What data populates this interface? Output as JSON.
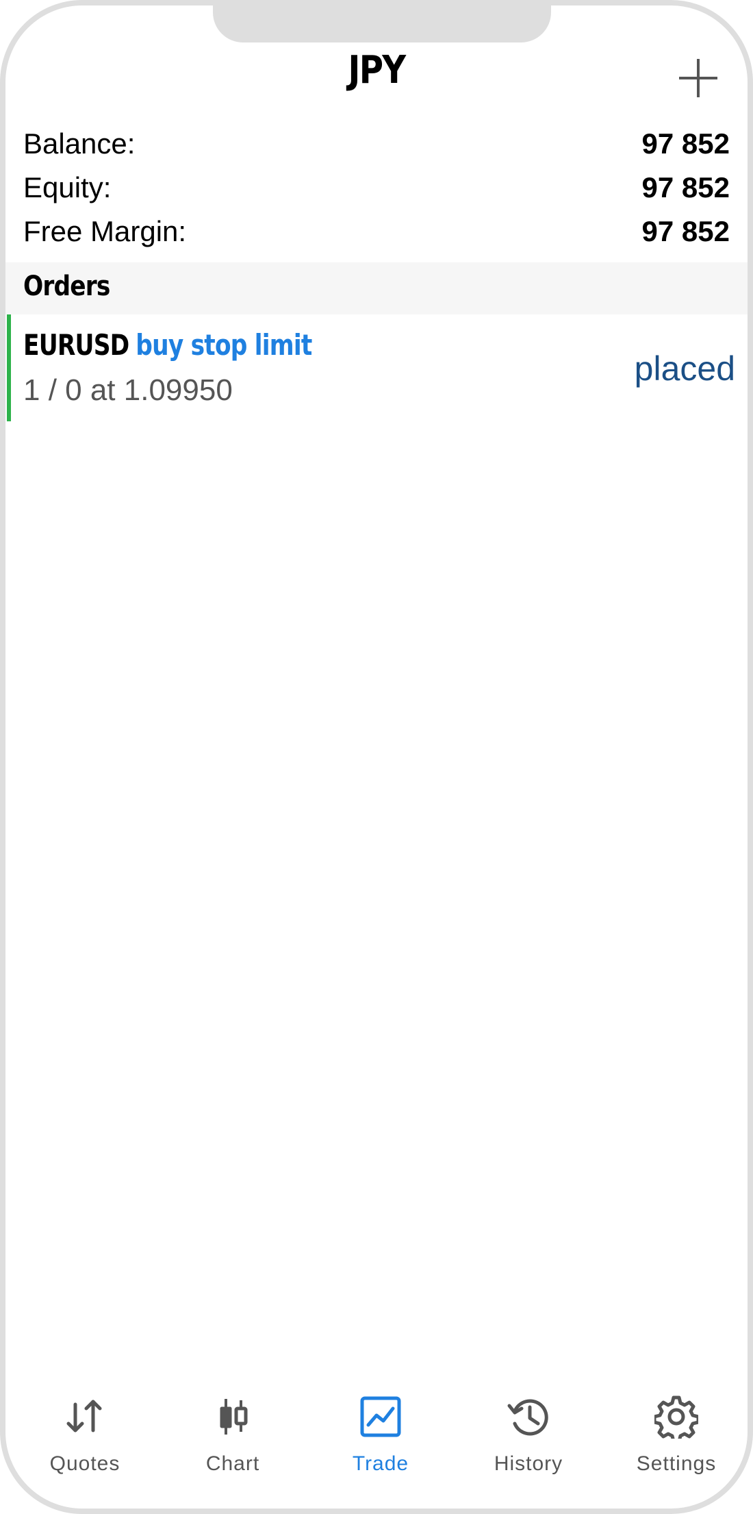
{
  "header": {
    "title": "JPY",
    "add_icon": "plus-icon"
  },
  "account": [
    {
      "label": "Balance:",
      "value": "97 852"
    },
    {
      "label": "Equity:",
      "value": "97 852"
    },
    {
      "label": "Free Margin:",
      "value": "97 852"
    }
  ],
  "orders": {
    "section_title": "Orders",
    "items": [
      {
        "symbol": "EURUSD",
        "type": "buy stop limit",
        "details": "1 / 0 at 1.09950",
        "status": "placed"
      }
    ]
  },
  "tabbar": {
    "tabs": [
      {
        "label": "Quotes",
        "icon": "arrows-up-down-icon",
        "active": false
      },
      {
        "label": "Chart",
        "icon": "candlestick-icon",
        "active": false
      },
      {
        "label": "Trade",
        "icon": "trade-chart-icon",
        "active": true
      },
      {
        "label": "History",
        "icon": "history-clock-icon",
        "active": false
      },
      {
        "label": "Settings",
        "icon": "gear-icon",
        "active": false
      }
    ]
  },
  "colors": {
    "accent": "#1f80e0",
    "buy_indicator": "#2db24a",
    "status_text": "#1b4f86",
    "icon_gray": "#555555"
  }
}
